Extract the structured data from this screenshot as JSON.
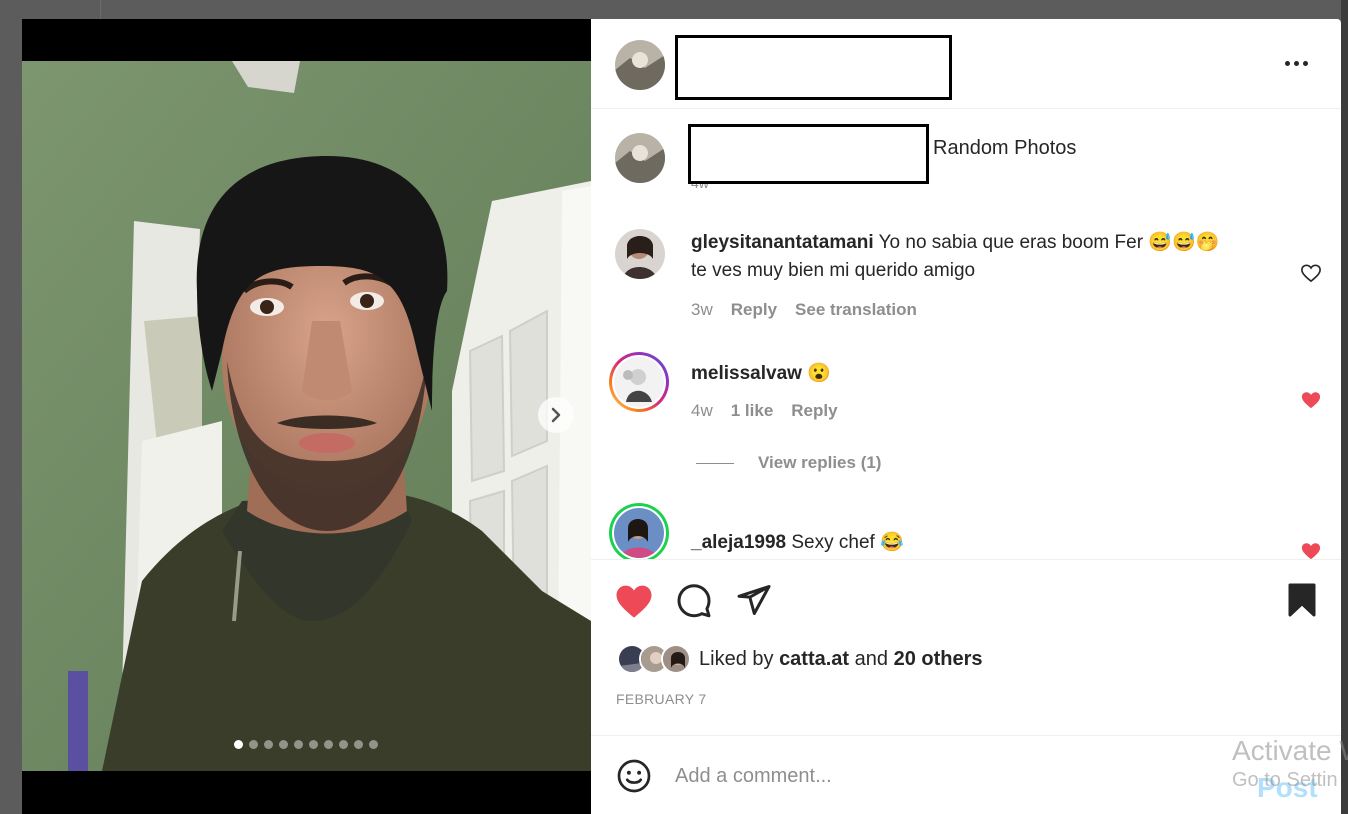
{
  "media": {
    "alt": "Photo of a man wearing a black beanie and dark green zip sweater",
    "slides_count": 10,
    "active_slide": 0
  },
  "post": {
    "caption": "Random Photos",
    "caption_time": "4w",
    "date": "FEBRUARY 7",
    "liked_by_prefix": "Liked by",
    "liked_by_user": "catta.at",
    "liked_by_and": "and",
    "liked_by_others": "20 others"
  },
  "comments": [
    {
      "user": "gleysitanantatamani",
      "text_line1": "Yo no sabia que eras boom Fer 😅😅🤭",
      "text_line2": "te ves muy bien mi querido amigo",
      "time": "3w",
      "reply": "Reply",
      "translation": "See translation",
      "liked": false
    },
    {
      "user": "melissalvaw",
      "text": "😮",
      "time": "4w",
      "likes": "1 like",
      "reply": "Reply",
      "liked": true,
      "view_replies": "View replies (1)"
    },
    {
      "user": "_aleja1998",
      "text": "Sexy chef 😂",
      "liked": true
    }
  ],
  "composer": {
    "placeholder": "Add a comment...",
    "post_label": "Post"
  },
  "watermark": {
    "line1": "Activate W",
    "line2": "Go to Settin"
  },
  "colors": {
    "like_red": "#ed4956",
    "text": "#262626",
    "secondary": "#8e8e8e",
    "post_blue": "#b2dffc",
    "story_ring_gradient": [
      "#feda75",
      "#fa7e1e",
      "#d62976",
      "#962fbf"
    ],
    "close_friends_ring": "#1cd14f"
  },
  "icons": {
    "more": "more-options-icon",
    "like": "heart-filled-icon",
    "comment": "comment-bubble-icon",
    "share": "paper-plane-icon",
    "save": "bookmark-filled-icon",
    "emoji": "smiley-icon",
    "next": "chevron-right-icon"
  }
}
